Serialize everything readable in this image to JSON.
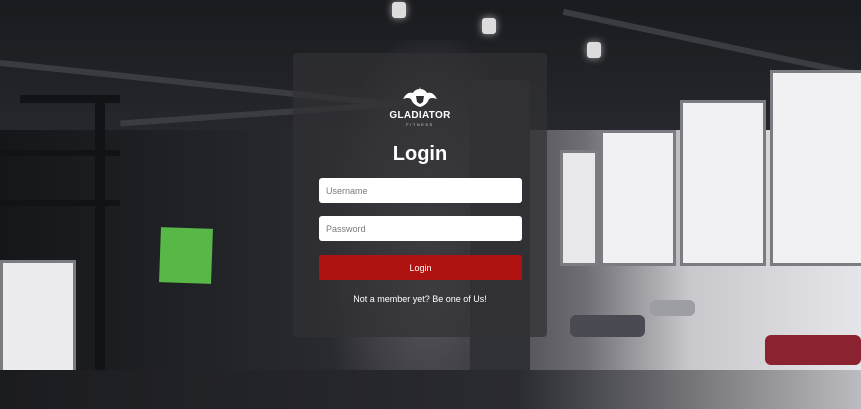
{
  "brand": {
    "name": "GLADIATOR",
    "tagline": "FITNESS",
    "logo_icon": "gladiator-helmet-icon"
  },
  "login": {
    "title": "Login",
    "username_placeholder": "Username",
    "password_placeholder": "Password",
    "username_value": "",
    "password_value": "",
    "submit_label": "Login"
  },
  "signup": {
    "prompt": "Not a member yet?",
    "link_label": "Be one of Us!"
  },
  "colors": {
    "accent": "#b0120f",
    "card_bg": "#303034",
    "text": "#ffffff"
  }
}
